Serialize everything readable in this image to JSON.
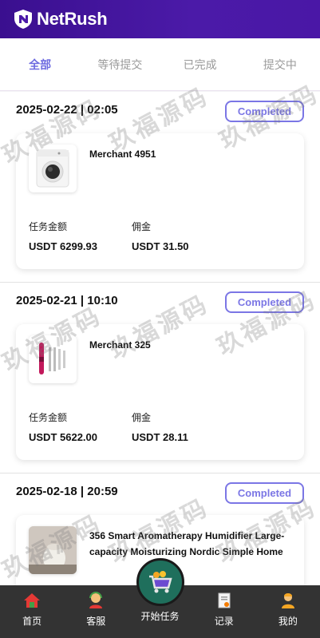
{
  "app": {
    "brand": "NetRush"
  },
  "tabs": [
    {
      "label": "全部",
      "active": true
    },
    {
      "label": "等待提交",
      "active": false
    },
    {
      "label": "已完成",
      "active": false
    },
    {
      "label": "提交中",
      "active": false
    }
  ],
  "orders": [
    {
      "time": "2025-02-22 | 02:05",
      "status": "Completed",
      "merchant": "Merchant 4951",
      "amount_label": "任务金额",
      "amount": "USDT 6299.93",
      "commission_label": "佣金",
      "commission": "USDT 31.50",
      "product_icon": "washing-machine-icon"
    },
    {
      "time": "2025-02-21 | 10:10",
      "status": "Completed",
      "merchant": "Merchant 325",
      "amount_label": "任务金额",
      "amount": "USDT 5622.00",
      "commission_label": "佣金",
      "commission": "USDT 28.11",
      "product_icon": "hair-styler-icon"
    },
    {
      "time": "2025-02-18 | 20:59",
      "status": "Completed",
      "merchant": "356 Smart Aromatherapy Humidifier Large-capacity Moisturizing Nordic Simple Home",
      "product_icon": "humidifier-icon"
    }
  ],
  "watermark": "玖福源码",
  "bottom_nav": [
    {
      "label": "首页",
      "icon": "home-icon"
    },
    {
      "label": "客服",
      "icon": "support-agent-icon"
    },
    {
      "label": "开始任务",
      "icon": "shopping-cart-icon"
    },
    {
      "label": "记录",
      "icon": "record-icon"
    },
    {
      "label": "我的",
      "icon": "user-icon"
    }
  ],
  "colors": {
    "header": "#4b1aa8",
    "accent": "#7b76e5",
    "nav_bg": "#333333",
    "center_button": "#1f6f5c"
  }
}
